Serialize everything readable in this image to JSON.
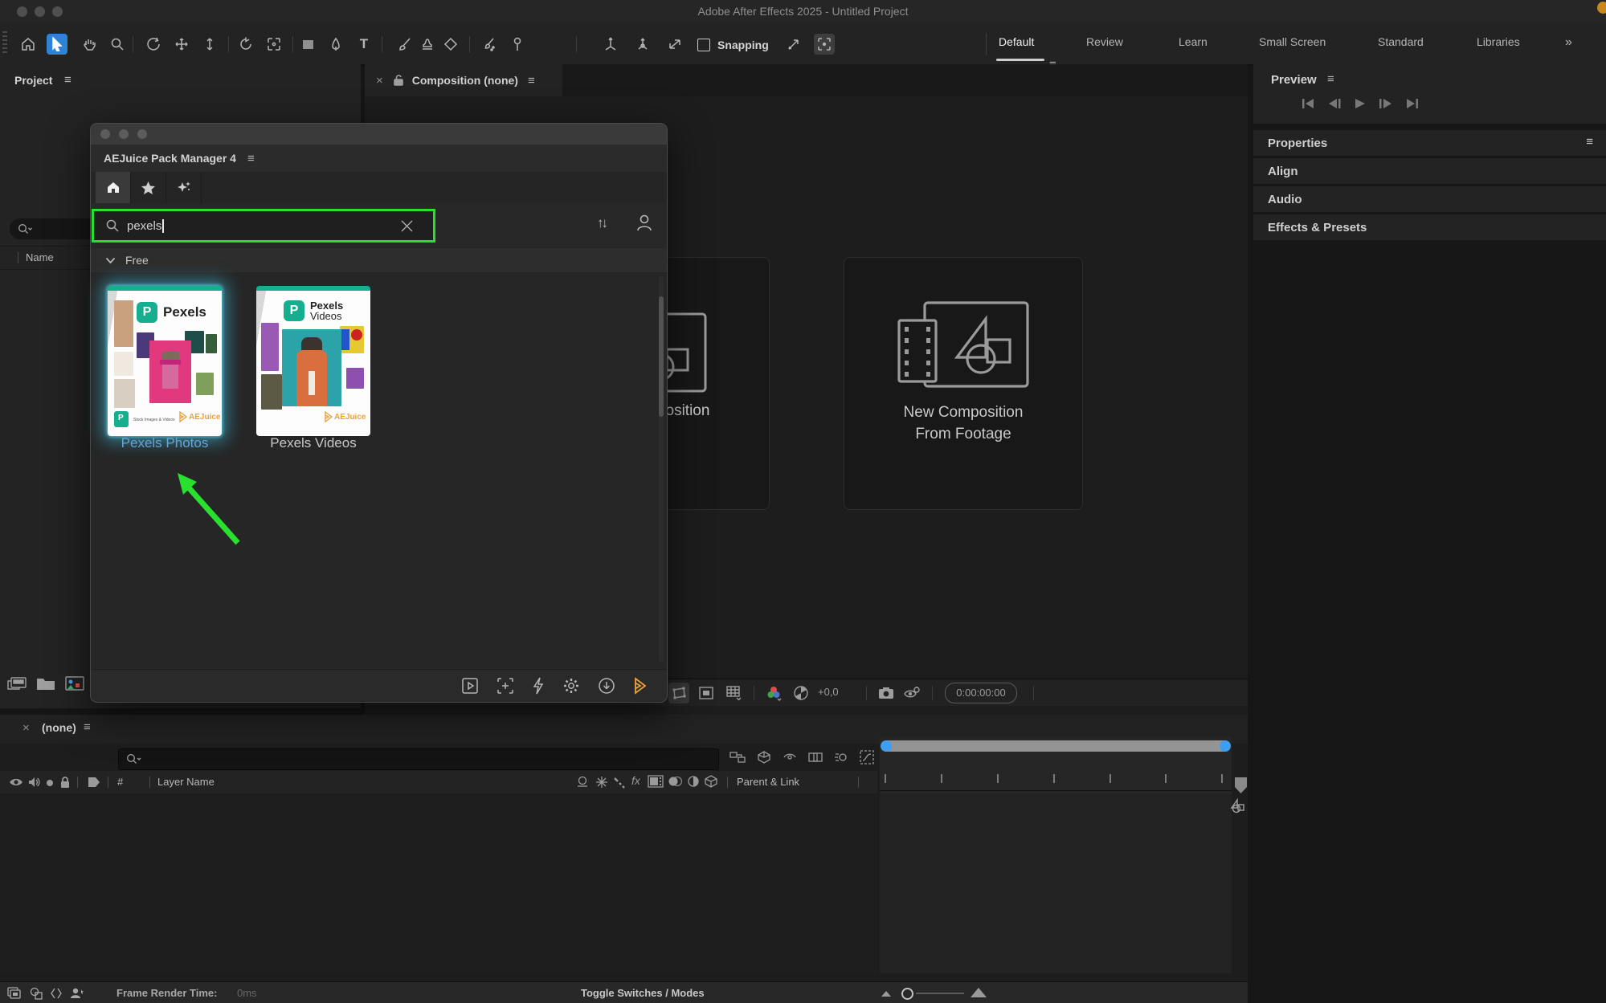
{
  "window": {
    "title": "Adobe After Effects 2025 - Untitled Project"
  },
  "toolbar": {
    "snapping_label": "Snapping"
  },
  "workspace": {
    "tabs": [
      "Default",
      "Review",
      "Learn",
      "Small Screen",
      "Standard",
      "Libraries"
    ],
    "active_tab": "Default",
    "overflow": "»"
  },
  "project": {
    "title": "Project",
    "columns": {
      "name": "Name"
    }
  },
  "comp": {
    "close": "×",
    "tab_label": "Composition (none)",
    "left_card_label": "New Composition",
    "right_card_line1": "New Composition",
    "right_card_line2": "From Footage",
    "exposure": "+0,0",
    "timecode": "0:00:00:00"
  },
  "dialog": {
    "title": "AEJuice Pack Manager 4",
    "search_value": "pexels",
    "section": "Free",
    "products": [
      {
        "name": "Pexels Photos",
        "brand": "Pexels",
        "subtitle": "Stock Images & Videos",
        "publisher": "AEJuice",
        "selected": true
      },
      {
        "name": "Pexels Videos",
        "brand_line1": "Pexels",
        "brand_line2": "Videos",
        "publisher": "AEJuice",
        "selected": false
      }
    ]
  },
  "preview": {
    "title": "Preview",
    "sections": [
      "Properties",
      "Align",
      "Audio",
      "Effects & Presets"
    ]
  },
  "timeline": {
    "close": "×",
    "tab_label": "(none)",
    "columns": {
      "index": "#",
      "layer_name": "Layer Name",
      "parent_link": "Parent & Link"
    },
    "fx_glyph": "fx"
  },
  "status": {
    "frame_render_label": "Frame Render Time:",
    "frame_render_value": "0ms",
    "toggle_label": "Toggle Switches / Modes"
  },
  "glyphs": {
    "menu": "≡",
    "sort": "↑↓",
    "type_tool": "T"
  },
  "colors": {
    "highlight_green": "#29e02e",
    "selection_blue": "#2f83d6",
    "pexels_teal": "#15af8f",
    "aejuice_orange": "#e8a33d",
    "selected_link_blue": "#63a4d9"
  }
}
